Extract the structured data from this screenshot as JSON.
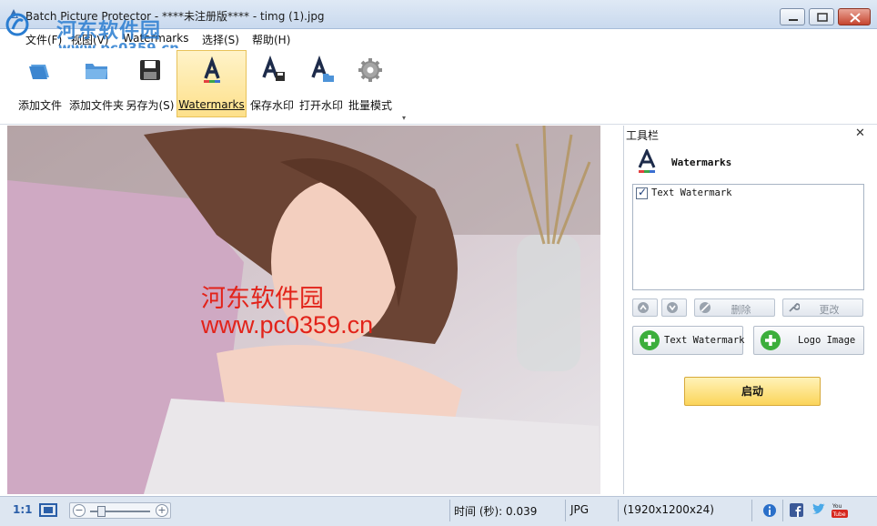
{
  "window": {
    "title": "Batch Picture Protector - ****未注册版**** - timg (1).jpg"
  },
  "overlay_logo": {
    "text": "河东软件园",
    "url": "www.pc0359.cn"
  },
  "menu": {
    "items": [
      "文件(F)",
      "视图(V)",
      "Watermarks",
      "选择(S)",
      "帮助(H)"
    ]
  },
  "toolbar": {
    "items": [
      {
        "label": "添加文件",
        "icon": "add-file-icon"
      },
      {
        "label": "添加文件夹",
        "icon": "add-folder-icon"
      },
      {
        "label": "另存为(S)",
        "icon": "save-icon"
      },
      {
        "label": "Watermarks",
        "icon": "watermark-a-icon",
        "active": true
      },
      {
        "label": "保存水印",
        "icon": "save-watermark-icon"
      },
      {
        "label": "打开水印",
        "icon": "open-watermark-icon"
      },
      {
        "label": "批量模式",
        "icon": "gear-icon"
      }
    ]
  },
  "image": {
    "watermark_line1": "河东软件园",
    "watermark_line2": "www.pc0359.cn",
    "watermark_color": "#e2231a"
  },
  "panel": {
    "title": "工具栏",
    "heading": "Watermarks",
    "list": [
      {
        "label": "Text Watermark",
        "checked": true
      }
    ],
    "buttons": {
      "delete": "删除",
      "edit": "更改",
      "add_text": "Text Watermark",
      "add_logo": "Logo Image",
      "start": "启动"
    }
  },
  "status": {
    "zoom_ratio": "1:1",
    "time": "时间 (秒): 0.039",
    "format": "JPG",
    "dimensions": "(1920x1200x24)"
  },
  "colors": {
    "accent": "#fde08a",
    "start_button": "#fbd45a",
    "status_bg": "#dde6f1"
  }
}
